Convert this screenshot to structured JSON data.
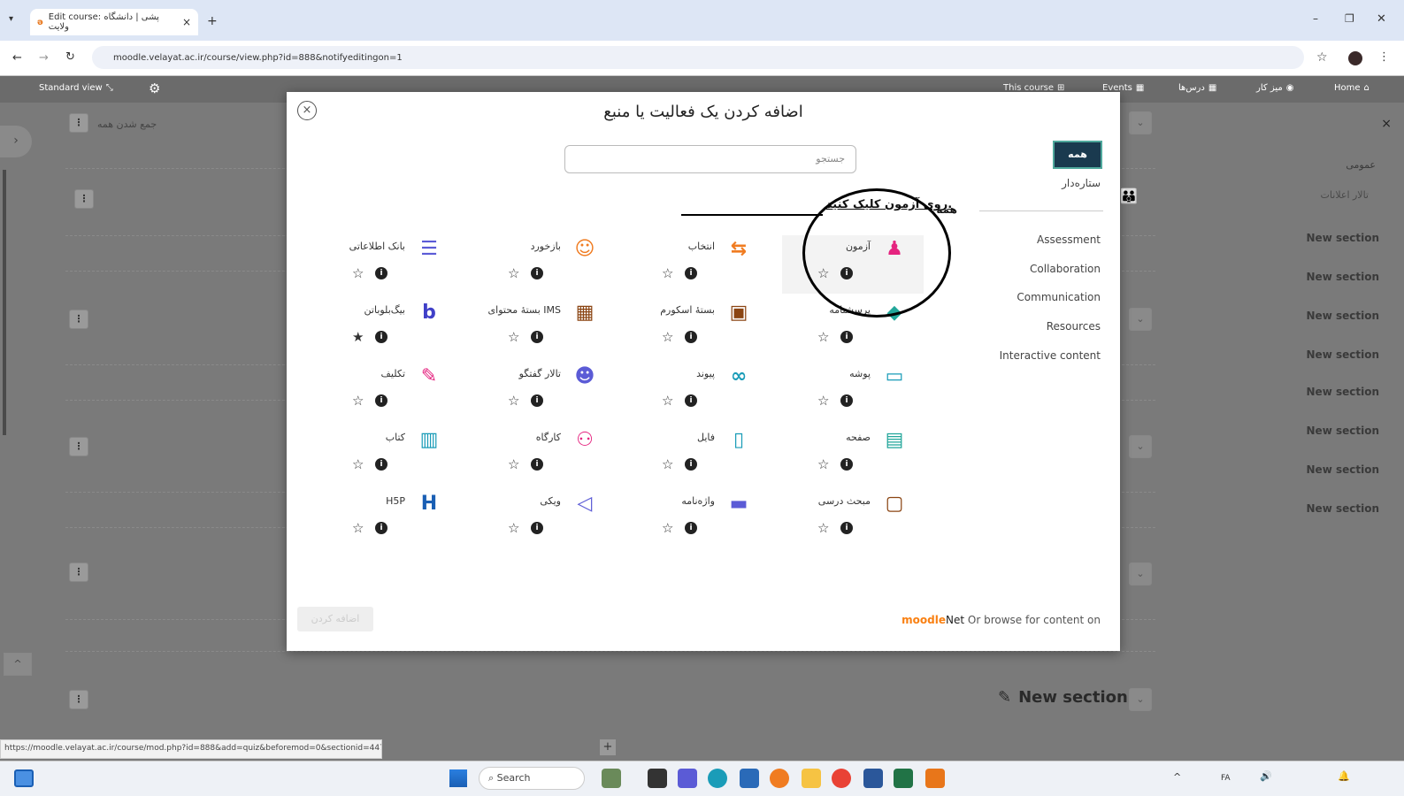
{
  "browser": {
    "tab_title": "Edit course: پشی | دانشگاه ولایت",
    "tab_close": "×",
    "new_tab": "+",
    "url": "moodle.velayat.ac.ir/course/view.php?id=888&notifyeditingon=1",
    "status_url": "https://moodle.velayat.ac.ir/course/mod.php?id=888&add=quiz&beforemod=0&sectionid=4476"
  },
  "navbar": {
    "standard_view": "Standard view",
    "this_course": "This course",
    "events": "Events",
    "my_courses": "درس‌ها",
    "dashboard": "میز کار",
    "home": "Home"
  },
  "course": {
    "collapse_all": "جمع شدن همه",
    "general": "عمومی",
    "announcements": "تالار اعلانات",
    "section_label": "New section",
    "big_section": "New section"
  },
  "modal": {
    "title": "اضافه کردن یک فعالیت یا منبع",
    "search_placeholder": "جستجو",
    "all_tab": "همه",
    "starred": "ستاره‌دار",
    "all_heading": "همه",
    "hint": "روی آزمون کلیک کنید.",
    "categories": [
      "Assessment",
      "Collaboration",
      "Communication",
      "Resources",
      "Interactive content"
    ],
    "add_button": "اضافه کردن",
    "moodlenet_prefix": "Or browse for content on",
    "moodlenet_brand": "moodle",
    "moodlenet_suffix": "Net",
    "activities": [
      {
        "label": "آزمون",
        "icon": "quiz-icon",
        "color": "#e5237f"
      },
      {
        "label": "انتخاب",
        "icon": "choice-icon",
        "color": "#f07c21"
      },
      {
        "label": "بازخورد",
        "icon": "feedback-icon",
        "color": "#f07c21"
      },
      {
        "label": "بانک اطلاعاتی",
        "icon": "database-icon",
        "color": "#5b5bd6"
      },
      {
        "label": "پرسشنامه",
        "icon": "lesson-icon",
        "color": "#22a69a"
      },
      {
        "label": "بستهٔ اسکورم",
        "icon": "scorm-icon",
        "color": "#8b4513"
      },
      {
        "label": "بستهٔ محتوای IMS",
        "icon": "ims-icon",
        "color": "#8b4513"
      },
      {
        "label": "بیگ‌بلوباتن",
        "icon": "bigbluebutton-icon",
        "color": "#4040c8"
      },
      {
        "label": "پوشه",
        "icon": "folder-icon",
        "color": "#1a9cb8"
      },
      {
        "label": "پیوند",
        "icon": "url-icon",
        "color": "#1a9cb8"
      },
      {
        "label": "تالار گفتگو",
        "icon": "forum-icon",
        "color": "#5b5bd6"
      },
      {
        "label": "تکلیف",
        "icon": "assign-icon",
        "color": "#e5237f"
      },
      {
        "label": "صفحه",
        "icon": "page-icon",
        "color": "#22a69a"
      },
      {
        "label": "فایل",
        "icon": "file-icon",
        "color": "#1a9cb8"
      },
      {
        "label": "کارگاه",
        "icon": "workshop-icon",
        "color": "#e5237f"
      },
      {
        "label": "کتاب",
        "icon": "book-icon",
        "color": "#1a9cb8"
      },
      {
        "label": "مبحث درسی",
        "icon": "lesson-board-icon",
        "color": "#8b4513"
      },
      {
        "label": "واژه‌نامه",
        "icon": "glossary-icon",
        "color": "#5b5bd6"
      },
      {
        "label": "ویکی",
        "icon": "wiki-icon",
        "color": "#5b5bd6"
      },
      {
        "label": "H5P",
        "icon": "h5p-icon",
        "color": "#1a5fb4"
      }
    ]
  },
  "taskbar": {
    "search": "Search",
    "lang": "FA"
  }
}
